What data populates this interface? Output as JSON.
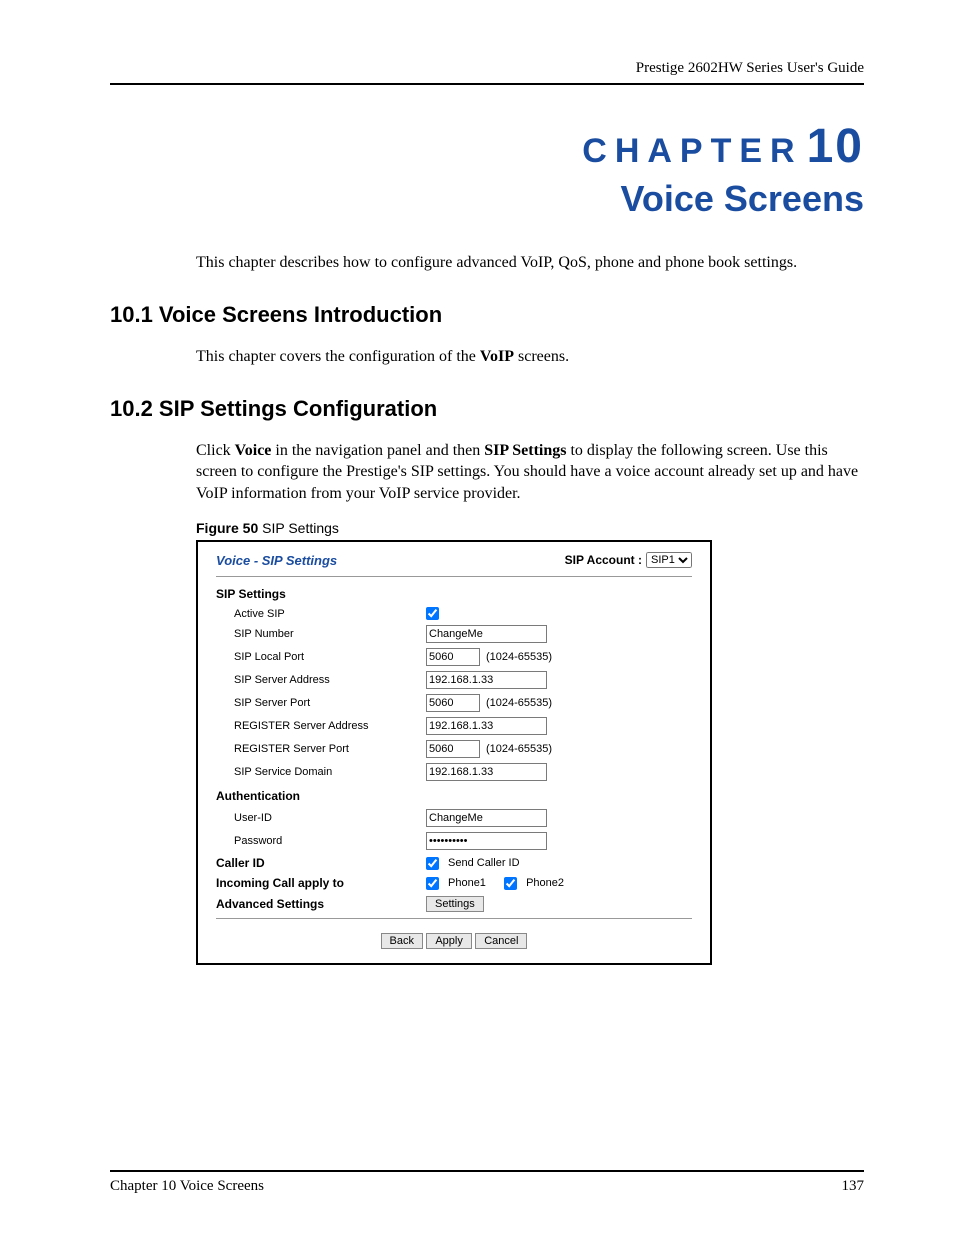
{
  "header": {
    "guide_title": "Prestige 2602HW Series User's Guide"
  },
  "chapter": {
    "label": "CHAPTER",
    "number": "10",
    "title": "Voice Screens",
    "intro": "This chapter describes how to configure advanced VoIP, QoS, phone and phone book settings."
  },
  "sections": {
    "s1": {
      "heading": "10.1  Voice Screens Introduction",
      "body_pre": "This chapter covers the configuration of the ",
      "body_bold": "VoIP",
      "body_post": " screens."
    },
    "s2": {
      "heading": "10.2  SIP Settings Configuration",
      "body_pre": "Click ",
      "body_b1": "Voice",
      "body_mid1": " in the navigation panel and then ",
      "body_b2": "SIP Settings",
      "body_mid2": " to display the following screen. Use this screen to configure the Prestige's SIP settings. You should have a voice account already set up and have VoIP information from your VoIP service provider."
    }
  },
  "figure": {
    "caption_bold": "Figure 50",
    "caption_rest": "   SIP Settings"
  },
  "screenshot": {
    "panel_title": "Voice - SIP Settings",
    "account_label": "SIP Account :",
    "account_value": "SIP1",
    "sip_settings_label": "SIP Settings",
    "rows": {
      "active_sip": {
        "label": "Active SIP",
        "checked": true
      },
      "sip_number": {
        "label": "SIP Number",
        "value": "ChangeMe"
      },
      "sip_local_port": {
        "label": "SIP Local Port",
        "value": "5060",
        "hint": "(1024-65535)"
      },
      "sip_server_addr": {
        "label": "SIP Server Address",
        "value": "192.168.1.33"
      },
      "sip_server_port": {
        "label": "SIP Server Port",
        "value": "5060",
        "hint": "(1024-65535)"
      },
      "reg_server_addr": {
        "label": "REGISTER Server Address",
        "value": "192.168.1.33"
      },
      "reg_server_port": {
        "label": "REGISTER Server Port",
        "value": "5060",
        "hint": "(1024-65535)"
      },
      "sip_service_domain": {
        "label": "SIP Service Domain",
        "value": "192.168.1.33"
      }
    },
    "auth_label": "Authentication",
    "auth": {
      "user_id": {
        "label": "User-ID",
        "value": "ChangeMe"
      },
      "password": {
        "label": "Password",
        "value": "••••••••••"
      }
    },
    "caller_id": {
      "label": "Caller ID",
      "checkbox_label": "Send Caller ID",
      "checked": true
    },
    "incoming": {
      "label": "Incoming Call apply to",
      "phone1_label": "Phone1",
      "phone1_checked": true,
      "phone2_label": "Phone2",
      "phone2_checked": true
    },
    "advanced": {
      "label": "Advanced Settings",
      "button": "Settings"
    },
    "buttons": {
      "back": "Back",
      "apply": "Apply",
      "cancel": "Cancel"
    }
  },
  "footer": {
    "left": "Chapter 10 Voice Screens",
    "right": "137"
  }
}
